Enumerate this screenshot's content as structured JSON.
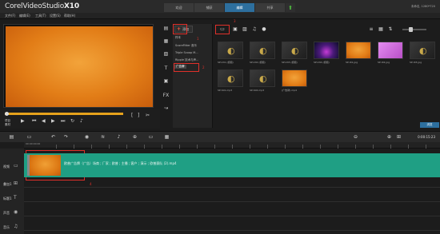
{
  "app": {
    "brand": "Corel",
    "product": "VideoStudio",
    "version": "X10"
  },
  "tabs": [
    {
      "label": "欢迎",
      "active": false
    },
    {
      "label": "捕获",
      "active": false
    },
    {
      "label": "编辑",
      "active": true
    },
    {
      "label": "共享",
      "active": false
    },
    {
      "label": "⬆",
      "active": false
    }
  ],
  "userinfo": "未命名, 1280*720",
  "menu": [
    "文件(F)",
    "编辑(E)",
    "工具(T)",
    "设置(S)",
    "帮助(H)"
  ],
  "preview": {
    "mode_project": "项目",
    "mode_clip": "素材"
  },
  "library": {
    "add_label": "添加",
    "folders": [
      {
        "label": "样本",
        "selected": false
      },
      {
        "label": "ScoreFitter 音乐",
        "selected": false
      },
      {
        "label": "Triple Scoop M...",
        "selected": false
      },
      {
        "label": "Ripple 技术与声...",
        "selected": false
      },
      {
        "label": "广告牌",
        "selected": true
      }
    ],
    "annotations": [
      "1",
      "2",
      "3",
      "4"
    ],
    "thumbnails": [
      {
        "label": "SP-V01 (视频)",
        "kind": "dark"
      },
      {
        "label": "SP-V02 (视频)",
        "kind": "dark"
      },
      {
        "label": "SP-V03 (视频)",
        "kind": "dark"
      },
      {
        "label": "SP-V04 (视频)",
        "kind": "stage"
      },
      {
        "label": "SP-I01.jpg",
        "kind": "orange"
      },
      {
        "label": "SP-I02.jpg",
        "kind": "pink"
      },
      {
        "label": "SP-I03.jpg",
        "kind": "dark"
      },
      {
        "label": "SP-S01.mp3",
        "kind": "dark"
      },
      {
        "label": "SP-S02.mp3",
        "kind": "dark"
      },
      {
        "label": "(广告牌).mp4",
        "kind": "orange"
      }
    ],
    "browse_label": "浏览"
  },
  "timeline": {
    "timecode": "0:00:15:23",
    "ruler_start": "00:00:00:00",
    "tracks": [
      "视频",
      "叠加1",
      "标题1",
      "声音",
      "音乐"
    ],
    "clip_label": "欧普广告牌（广告）场商 ; 厂家 ; 欧普 ; 主播 ; 客户 ; 演示 ; 欧普赛队 (2).mp4"
  },
  "colors": {
    "accent_blue": "#2d6f9e",
    "track_green": "#1f9f84",
    "annotation_red": "#e0302a",
    "preview_orange": "#e27d17"
  }
}
